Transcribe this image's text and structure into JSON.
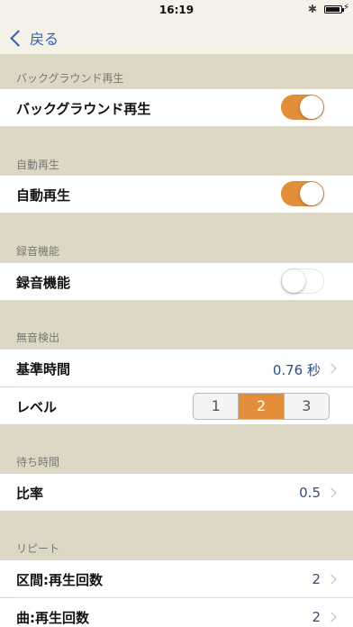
{
  "status": {
    "time": "16:19",
    "bluetooth": "✱"
  },
  "nav": {
    "back_label": "戻る"
  },
  "sections": {
    "background": {
      "header": "バックグラウンド再生",
      "label": "バックグラウンド再生",
      "on": true
    },
    "autoplay": {
      "header": "自動再生",
      "label": "自動再生",
      "on": true
    },
    "recording": {
      "header": "録音機能",
      "label": "録音機能",
      "on": false
    },
    "silence": {
      "header": "無音検出",
      "base_time_label": "基準時間",
      "base_time_value": "0.76 秒",
      "level_label": "レベル",
      "level_options": [
        "1",
        "2",
        "3"
      ],
      "level_selected": "2"
    },
    "wait": {
      "header": "待ち時間",
      "ratio_label": "比率",
      "ratio_value": "0.5"
    },
    "repeat": {
      "header": "リピート",
      "section_count_label": "区間:再生回数",
      "section_count_value": "2",
      "song_count_label": "曲:再生回数",
      "song_count_value": "2"
    }
  },
  "colors": {
    "accent": "#e38e3a",
    "link": "#2f5fb5",
    "background": "#ddd8c6"
  }
}
